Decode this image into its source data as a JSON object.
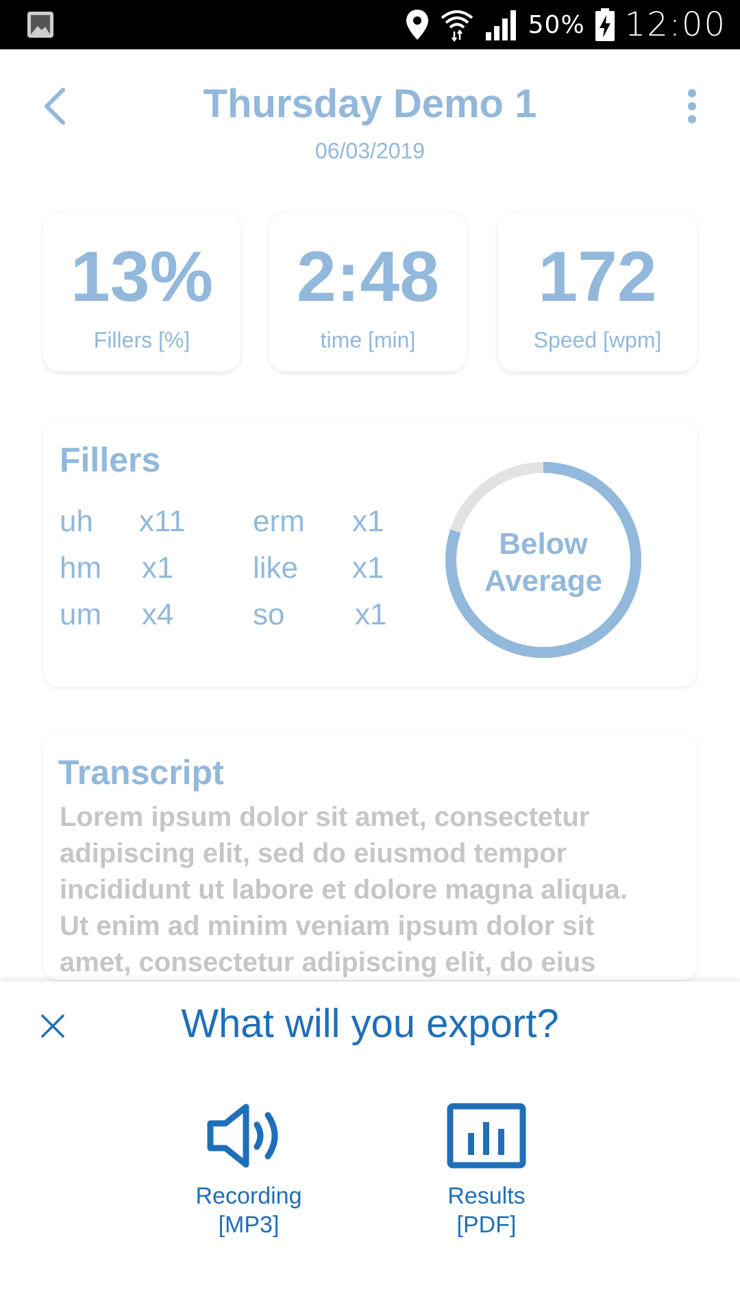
{
  "status_bar": {
    "battery_percent": "50%",
    "time": "12:00"
  },
  "header": {
    "title": "Thursday Demo 1",
    "date": "06/03/2019"
  },
  "stats": [
    {
      "value": "13%",
      "label": "Fillers [%]"
    },
    {
      "value": "2:48",
      "label": "time [min]"
    },
    {
      "value": "172",
      "label": "Speed [wpm]"
    }
  ],
  "fillers": {
    "title": "Fillers",
    "items": [
      {
        "word": "uh",
        "count": "x11"
      },
      {
        "word": "hm",
        "count": "x1"
      },
      {
        "word": "um",
        "count": "x4"
      },
      {
        "word": "erm",
        "count": "x1"
      },
      {
        "word": "like",
        "count": "x1"
      },
      {
        "word": "so",
        "count": "x1"
      }
    ],
    "rating_line1": "Below",
    "rating_line2": "Average",
    "ring_fill_fraction": 0.8
  },
  "transcript": {
    "title": "Transcript",
    "lines": [
      "Lorem ipsum dolor sit amet, consectetur",
      "adipiscing elit, sed do eiusmod tempor",
      "incididunt ut labore et dolore magna aliqua.",
      "Ut enim ad minim veniam ipsum dolor sit",
      "amet, consectetur adipiscing elit, do eius"
    ]
  },
  "export_sheet": {
    "title": "What will you export?",
    "options": [
      {
        "line1": "Recording",
        "line2": "[MP3]",
        "icon": "speaker-icon"
      },
      {
        "line1": "Results",
        "line2": "[PDF]",
        "icon": "bar-chart-icon"
      }
    ]
  },
  "colors": {
    "accent_light": "#92b8db",
    "accent_dark": "#1f6fb8",
    "ring_track": "#e2e2e2",
    "transcript_text": "#c6c6c6"
  }
}
